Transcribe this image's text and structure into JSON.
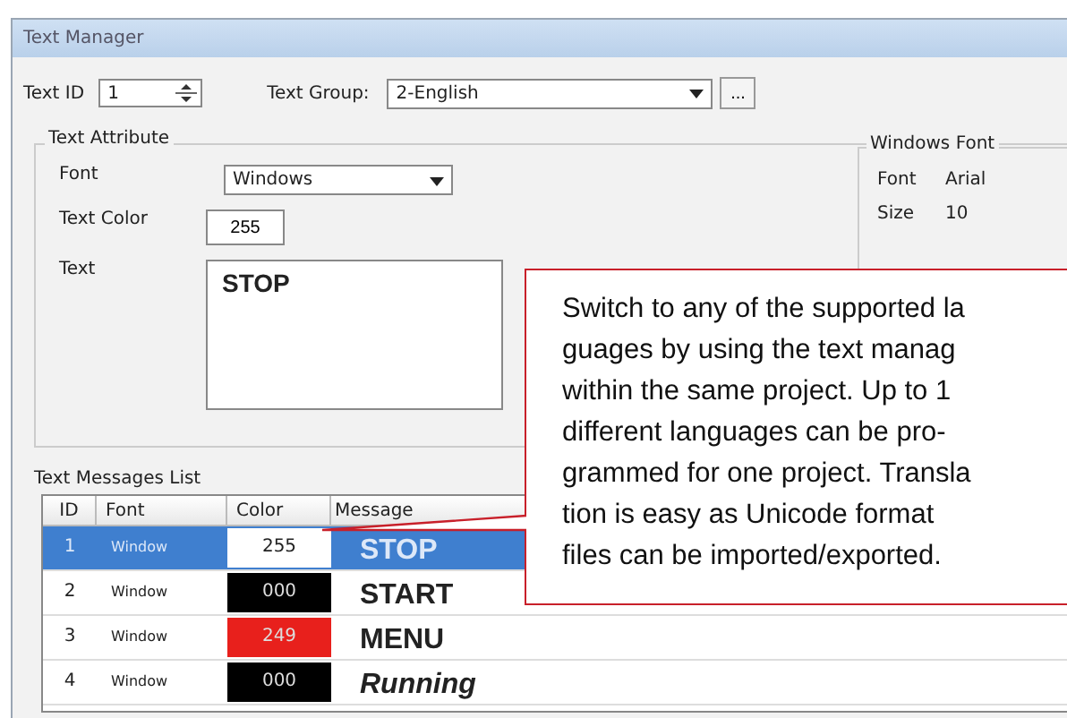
{
  "window": {
    "title": "Text Manager"
  },
  "top_row": {
    "text_id_label": "Text ID",
    "text_id": "1",
    "text_group_label": "Text Group:",
    "text_group": "2-English",
    "browse_button": "..."
  },
  "text_attribute": {
    "title": "Text Attribute",
    "font_label": "Font",
    "font": "Windows",
    "text_color_label": "Text Color",
    "text_color": "255",
    "text_label": "Text",
    "text": "STOP"
  },
  "windows_font": {
    "title": "Windows Font",
    "rows": [
      {
        "label": "Font",
        "value": "Arial"
      },
      {
        "label": "Size",
        "value": "10"
      }
    ]
  },
  "messages": {
    "title": "Text Messages List",
    "columns": [
      "ID",
      "Font",
      "Color",
      "Message"
    ],
    "rows": [
      {
        "id": "1",
        "font": "Window",
        "color_value": "255",
        "color": "#ffffff",
        "message": "STOP",
        "italic": false,
        "selected": true
      },
      {
        "id": "2",
        "font": "Window",
        "color_value": "000",
        "color": "#000000",
        "message": "START",
        "italic": false,
        "selected": false
      },
      {
        "id": "3",
        "font": "Window",
        "color_value": "249",
        "color": "#e8201c",
        "message": "MENU",
        "italic": false,
        "selected": false
      },
      {
        "id": "4",
        "font": "Window",
        "color_value": "000",
        "color": "#000000",
        "message": "Running",
        "italic": true,
        "selected": false
      }
    ]
  },
  "callout": {
    "lines": [
      "Switch to any of the supported la",
      "guages by using the text manag",
      "within the same project.  Up to 1",
      "different languages can be pro-",
      "grammed for one project. Transla",
      "tion is easy as Unicode format",
      "files can be imported/exported."
    ]
  }
}
